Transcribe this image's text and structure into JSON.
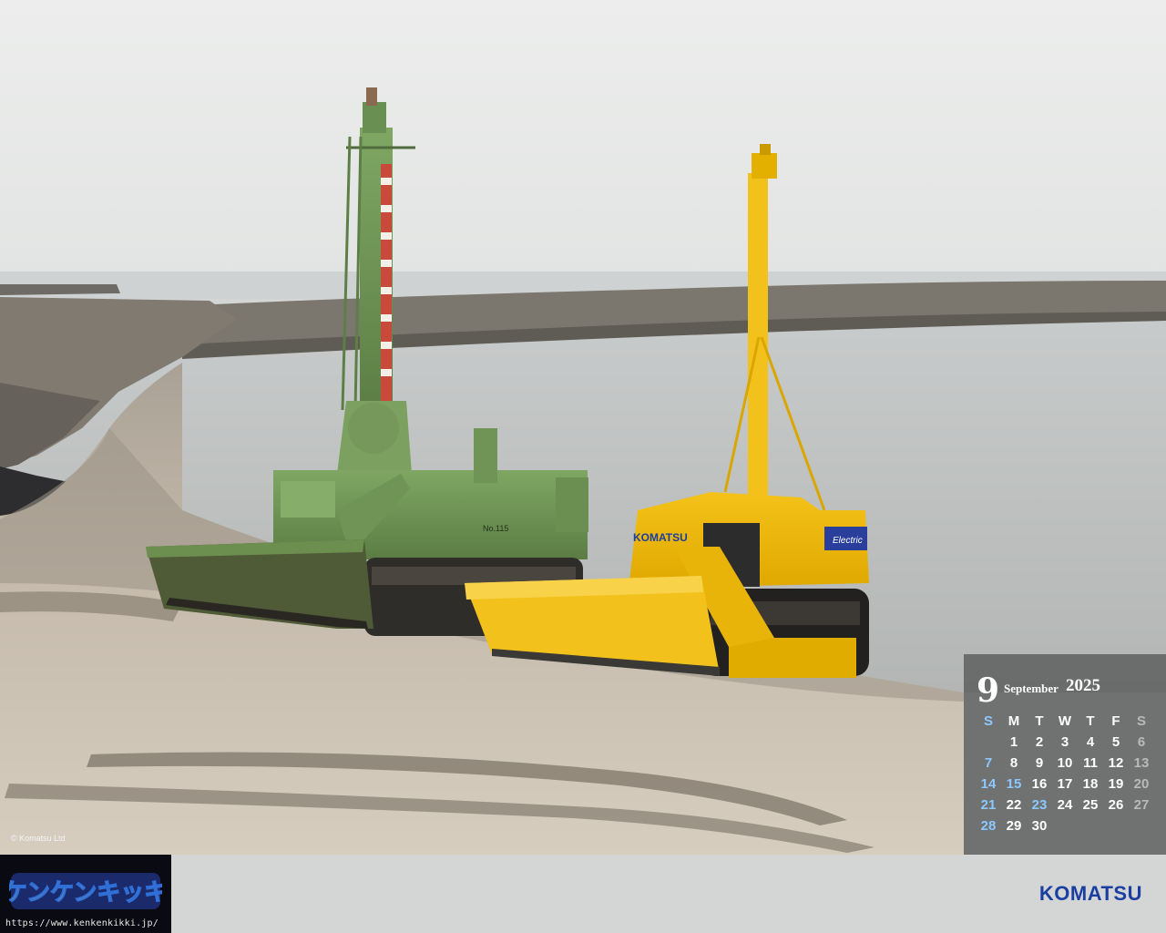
{
  "photo": {
    "copyright": "© Komatsu Ltd",
    "machine_labels": {
      "yellow_brand": "KOMATSU",
      "yellow_panel": "Electric",
      "green_number": "No.115"
    }
  },
  "calendar": {
    "month_number": "9",
    "month_name": "September",
    "year": "2025",
    "weekdays": [
      "S",
      "M",
      "T",
      "W",
      "T",
      "F",
      "S"
    ],
    "weeks": [
      [
        "",
        "1",
        "2",
        "3",
        "4",
        "5",
        "6"
      ],
      [
        "7",
        "8",
        "9",
        "10",
        "11",
        "12",
        "13"
      ],
      [
        "14",
        "15",
        "16",
        "17",
        "18",
        "19",
        "20"
      ],
      [
        "21",
        "22",
        "23",
        "24",
        "25",
        "26",
        "27"
      ],
      [
        "28",
        "29",
        "30",
        "",
        "",
        "",
        ""
      ]
    ],
    "holidays": [
      "15",
      "23"
    ],
    "colors": {
      "sunday": "#8cc8ff",
      "saturday": "#b9b9b9",
      "holiday": "#8cc8ff"
    }
  },
  "footer": {
    "site_logo_text": "ケンケンキッキ",
    "site_url": "https://www.kenkenkikki.jp/",
    "brand": "KOMATSU",
    "brand_color": "#1a3fa0"
  }
}
